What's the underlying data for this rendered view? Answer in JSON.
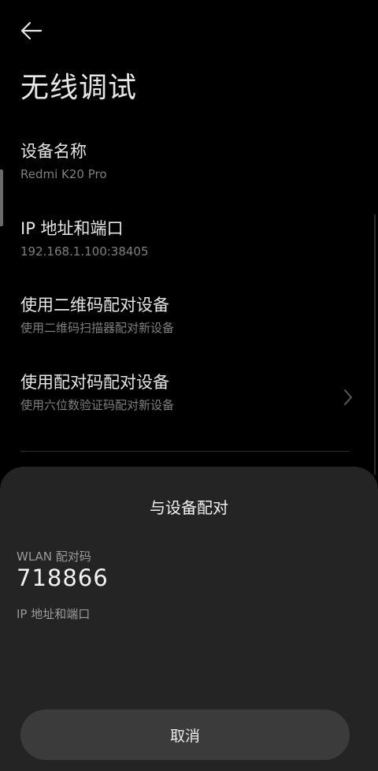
{
  "header": {
    "back_icon": "arrow-left-icon",
    "title": "无线调试"
  },
  "settings": {
    "device_name": {
      "title": "设备名称",
      "value": "Redmi K20 Pro"
    },
    "ip_port": {
      "title": "IP 地址和端口",
      "value": "192.168.1.100:38405"
    },
    "qr_pair": {
      "title": "使用二维码配对设备",
      "subtitle": "使用二维码扫描器配对新设备"
    },
    "code_pair": {
      "title": "使用配对码配对设备",
      "subtitle": "使用六位数验证码配对新设备",
      "chevron_icon": "chevron-right-icon"
    }
  },
  "dialog": {
    "title": "与设备配对",
    "wlan_label": "WLAN 配对码",
    "wlan_code": "718866",
    "ip_label": "IP 地址和端口",
    "cancel_label": "取消"
  },
  "colors": {
    "background": "#000000",
    "sheet": "#242424",
    "button": "#3b3b3b",
    "primary_text": "#e6e6e6",
    "secondary_text": "#7f7f7f"
  }
}
